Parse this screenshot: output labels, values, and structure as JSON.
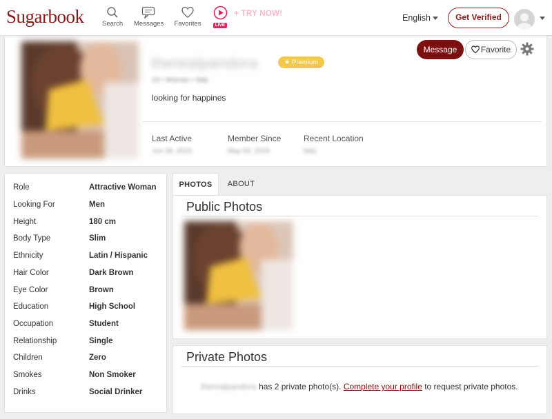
{
  "header": {
    "logo": "Sugarbook",
    "nav": {
      "search": "Search",
      "messages": "Messages",
      "favorites": "Favorites",
      "live_badge": "LIVE",
      "try_now": "+ TRY NOW!"
    },
    "language": "English",
    "get_verified": "Get Verified"
  },
  "profile": {
    "username": "therealpandora",
    "premium_badge": "★ Premium",
    "sub_info": "23 • Woman • Italy",
    "tagline": "looking for happines",
    "message_button": "Message",
    "favorite_button": "Favorite",
    "stats": [
      {
        "label": "Last Active",
        "value": "Jun 28, 2019"
      },
      {
        "label": "Member Since",
        "value": "May 03, 2019"
      },
      {
        "label": "Recent Location",
        "value": "Italy"
      }
    ]
  },
  "details": [
    {
      "key": "Role",
      "value": "Attractive Woman"
    },
    {
      "key": "Looking For",
      "value": "Men"
    },
    {
      "key": "Height",
      "value": "180 cm"
    },
    {
      "key": "Body Type",
      "value": "Slim"
    },
    {
      "key": "Ethnicity",
      "value": "Latin / Hispanic"
    },
    {
      "key": "Hair Color",
      "value": "Dark Brown"
    },
    {
      "key": "Eye Color",
      "value": "Brown"
    },
    {
      "key": "Education",
      "value": "High School"
    },
    {
      "key": "Occupation",
      "value": "Student"
    },
    {
      "key": "Relationship",
      "value": "Single"
    },
    {
      "key": "Children",
      "value": "Zero"
    },
    {
      "key": "Smokes",
      "value": "Non Smoker"
    },
    {
      "key": "Drinks",
      "value": "Social Drinker"
    }
  ],
  "tabs": {
    "photos": "PHOTOS",
    "about": "ABOUT"
  },
  "public_photos": {
    "title": "Public Photos"
  },
  "private_photos": {
    "title": "Private Photos",
    "username": "therealpandora",
    "text_before": " has 2 private photo(s). ",
    "link": "Complete your profile",
    "text_after": " to request private photos."
  },
  "colors": {
    "brand": "#7b1010",
    "premium": "#f2c94c",
    "live": "#e0245e"
  },
  "icons": [
    "search-icon",
    "messages-icon",
    "heart-icon",
    "live-play-icon",
    "chevron-down-icon",
    "gear-icon",
    "avatar-icon"
  ]
}
